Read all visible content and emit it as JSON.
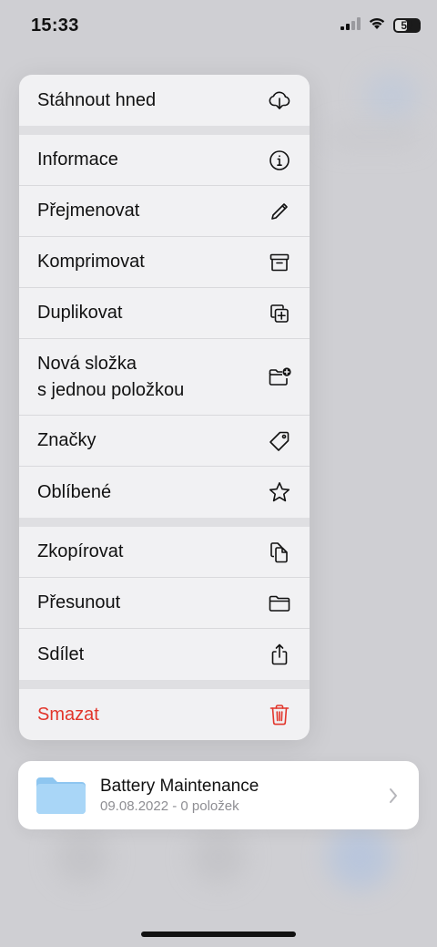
{
  "status_bar": {
    "time": "15:33",
    "battery_level": "50",
    "icons": [
      "cellular-signal-icon",
      "wifi-icon",
      "battery-icon"
    ]
  },
  "menu": {
    "groups": [
      {
        "items": [
          {
            "label": "Stáhnout hned",
            "icon": "cloud-download-icon"
          }
        ]
      },
      {
        "items": [
          {
            "label": "Informace",
            "icon": "info-icon"
          },
          {
            "label": "Přejmenovat",
            "icon": "pencil-icon"
          },
          {
            "label": "Komprimovat",
            "icon": "archive-box-icon"
          },
          {
            "label": "Duplikovat",
            "icon": "duplicate-icon"
          },
          {
            "label": "Nová složka\ns jednou položkou",
            "icon": "folder-badge-plus-icon"
          },
          {
            "label": "Značky",
            "icon": "tag-icon"
          },
          {
            "label": "Oblíbené",
            "icon": "star-icon"
          }
        ]
      },
      {
        "items": [
          {
            "label": "Zkopírovat",
            "icon": "copy-documents-icon"
          },
          {
            "label": "Přesunout",
            "icon": "folder-icon"
          },
          {
            "label": "Sdílet",
            "icon": "share-icon"
          }
        ]
      },
      {
        "items": [
          {
            "label": "Smazat",
            "icon": "trash-icon"
          }
        ]
      }
    ]
  },
  "folder_card": {
    "name": "Battery Maintenance",
    "meta": "09.08.2022 - 0 položek",
    "icon": "folder-thumbnail-icon"
  },
  "colors": {
    "destructive": "#e2352b",
    "folder_blue": "#9fd0f5",
    "menu_bg": "#f1f1f3"
  }
}
